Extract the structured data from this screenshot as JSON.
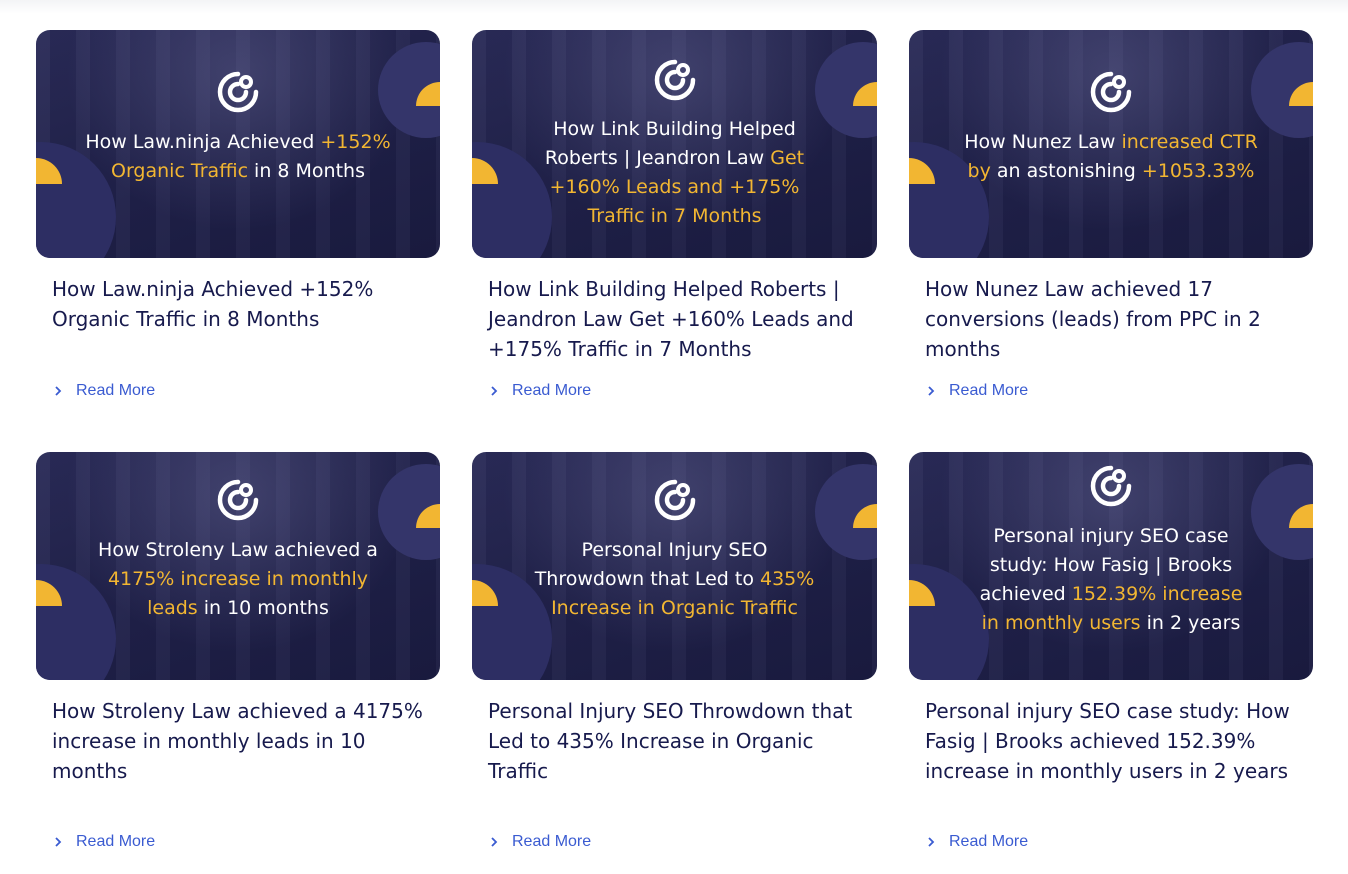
{
  "cards": [
    {
      "thumb": {
        "pre": "How Law.ninja Achieved ",
        "hl": "+152% Organic Traffic",
        "post": " in 8 Months"
      },
      "title": "How Law.ninja Achieved +152% Organic Traffic in 8 Months",
      "read_more": "Read More"
    },
    {
      "thumb": {
        "pre": "How Link Building Helped Roberts | Jeandron Law ",
        "hl": "Get +160% Leads and +175% Traffic in 7 Months",
        "post": ""
      },
      "title": "How Link Building Helped Roberts | Jeandron Law Get +160% Leads and +175% Traffic in 7 Months",
      "read_more": "Read More"
    },
    {
      "thumb": {
        "pre": "How Nunez Law ",
        "hl": "increased CTR by",
        "post": " an astonishing ",
        "hl2": "+1053.33%"
      },
      "title": "How Nunez Law achieved 17 conversions (leads) from PPC in 2 months",
      "read_more": "Read More"
    },
    {
      "thumb": {
        "pre": "How Stroleny Law achieved a ",
        "hl": "4175% increase in monthly leads",
        "post": " in 10 months"
      },
      "title": "How Stroleny Law achieved a 4175% increase in monthly leads in 10 months",
      "read_more": "Read More"
    },
    {
      "thumb": {
        "pre": "Personal Injury SEO Throwdown that Led to ",
        "hl": "435% Increase in Organic Traffic",
        "post": ""
      },
      "title": "Personal Injury SEO Throwdown that Led to 435% Increase in Organic Traffic",
      "read_more": "Read More"
    },
    {
      "thumb": {
        "pre": "Personal injury SEO case study: How Fasig | Brooks achieved ",
        "hl": "152.39% increase in monthly users",
        "post": " in 2 years"
      },
      "title": "Personal injury SEO case study: How Fasig | Brooks achieved 152.39% increase in monthly users in 2 years",
      "read_more": "Read More"
    }
  ],
  "colors": {
    "accent": "#f2b632",
    "title": "#171a4d",
    "link": "#3a5bd1",
    "thumb_bg": "#1f2049"
  },
  "icons": {
    "logo": "c-swirl-logo-icon",
    "read_more": "chevron-right-icon"
  }
}
